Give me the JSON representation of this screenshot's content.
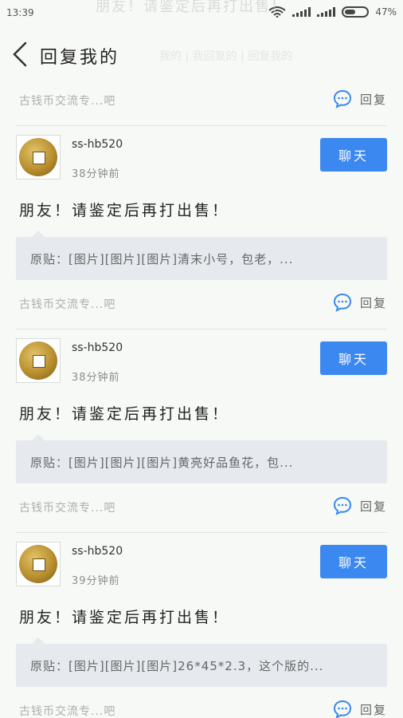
{
  "status_bar": {
    "time": "13:39",
    "battery": "47%"
  },
  "header": {
    "title": "回复我的",
    "back_icon": "chevron-left-icon"
  },
  "ghost": {
    "top": "朋友！请鉴定后再打出售！",
    "sub": "我的 | 我回复的 | 回复我的"
  },
  "top_meta": {
    "forum": "古钱币交流专...吧",
    "reply": "回复"
  },
  "colors": {
    "accent": "#3a88f0",
    "quote_bg": "#e6eaee"
  },
  "cards": [
    {
      "username": "ss-hb520",
      "time": "38分钟前",
      "chat": "聊天",
      "reply_text": "朋友！请鉴定后再打出售！",
      "quote": "原贴：[图片][图片][图片]清末小号，包老，...",
      "forum": "古钱币交流专...吧",
      "reply": "回复"
    },
    {
      "username": "ss-hb520",
      "time": "38分钟前",
      "chat": "聊天",
      "reply_text": "朋友！请鉴定后再打出售！",
      "quote": "原贴：[图片][图片][图片]黄亮好品鱼花，包...",
      "forum": "古钱币交流专...吧",
      "reply": "回复"
    },
    {
      "username": "ss-hb520",
      "time": "39分钟前",
      "chat": "聊天",
      "reply_text": "朋友！请鉴定后再打出售！",
      "quote": "原贴：[图片][图片][图片]26*45*2.3，这个版的...",
      "forum": "古钱币交流专...吧",
      "reply": "回复"
    }
  ]
}
